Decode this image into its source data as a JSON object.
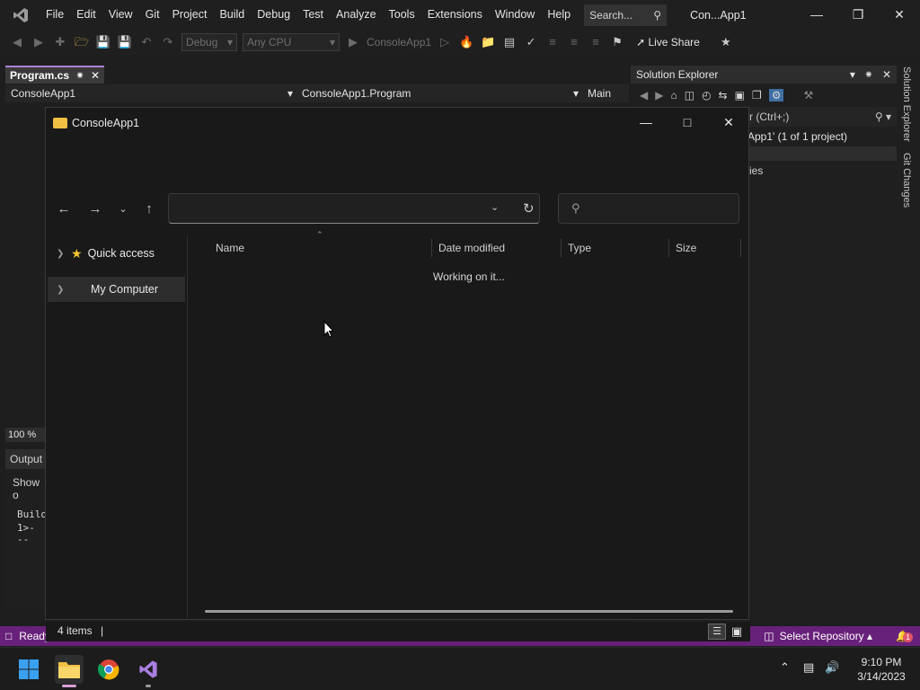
{
  "menubar": {
    "items": [
      "File",
      "Edit",
      "View",
      "Git",
      "Project",
      "Build",
      "Debug",
      "Test",
      "Analyze",
      "Tools",
      "Extensions",
      "Window",
      "Help"
    ],
    "search_label": "Search...",
    "window_title": "Con...App1"
  },
  "toolbar": {
    "config": "Debug",
    "platform": "Any CPU",
    "run_target": "ConsoleApp1",
    "live_share": "Live Share"
  },
  "editor": {
    "tab_label": "Program.cs",
    "nav_project": "ConsoleApp1",
    "nav_class": "ConsoleApp1.Program",
    "nav_member": "Main",
    "zoom": "100 %",
    "output_title": "Output",
    "output_show": "Show o",
    "output_line1": "Build",
    "output_line2": "1>---"
  },
  "solution_explorer": {
    "title": "Solution Explorer",
    "search_hint": "r (Ctrl+;)",
    "solution_line": "App1' (1 of 1 project)",
    "item_line": "ies"
  },
  "side_tabs": [
    "Solution Explorer",
    "Git Changes"
  ],
  "statusbar": {
    "ready": "Ready",
    "repo": "Select Repository",
    "notifications": "1"
  },
  "dialog": {
    "title": "ConsoleApp1",
    "address": "",
    "search_placeholder": "",
    "sidebar": [
      {
        "label": "Quick access"
      },
      {
        "label": "My Computer"
      }
    ],
    "columns": [
      "Name",
      "Date modified",
      "Type",
      "Size"
    ],
    "loading": "Working on it...",
    "item_count": "4 items"
  },
  "taskbar": {
    "time": "9:10 PM",
    "date": "3/14/2023"
  },
  "colors": {
    "accent": "#68217a",
    "selection": "#2d2d2d"
  }
}
